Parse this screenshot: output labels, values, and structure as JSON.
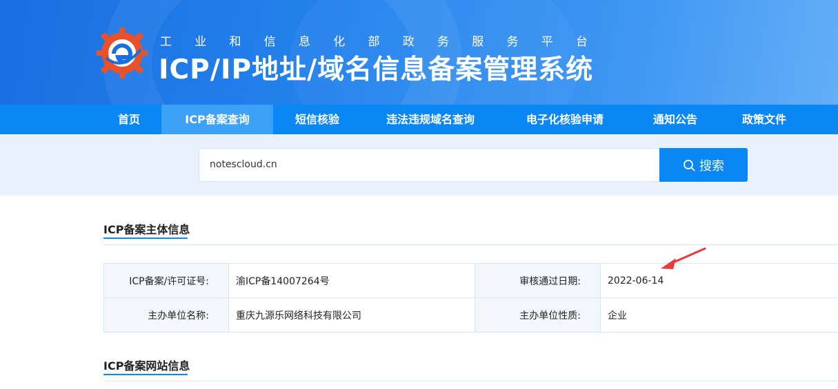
{
  "header": {
    "subtitle_chars": [
      "工",
      "业",
      "和",
      "信",
      "息",
      "化",
      "部",
      "政",
      "务",
      "服",
      "务",
      "平",
      "台"
    ],
    "title": "ICP/IP地址/域名信息备案管理系统"
  },
  "nav": {
    "items": [
      {
        "label": "首页"
      },
      {
        "label": "ICP备案查询"
      },
      {
        "label": "短信核验"
      },
      {
        "label": "违法违规域名查询"
      },
      {
        "label": "电子化核验申请"
      },
      {
        "label": "通知公告"
      },
      {
        "label": "政策文件"
      }
    ],
    "active_index": 1
  },
  "search": {
    "value": "notescloud.cn",
    "button_label": "搜索"
  },
  "subject_section": {
    "title": "ICP备案主体信息",
    "rows": [
      [
        {
          "label": "ICP备案/许可证号:",
          "value": "渝ICP备14007264号"
        },
        {
          "label": "审核通过日期:",
          "value": "2022-06-14"
        }
      ],
      [
        {
          "label": "主办单位名称:",
          "value": "重庆九源乐网络科技有限公司"
        },
        {
          "label": "主办单位性质:",
          "value": "企业"
        }
      ]
    ]
  },
  "website_section": {
    "title": "ICP备案网站信息"
  },
  "colors": {
    "primary": "#0a86f5",
    "nav_active": "#3da1f7",
    "search_strip": "#e8f2fc",
    "annotation_arrow": "#e8393b"
  }
}
